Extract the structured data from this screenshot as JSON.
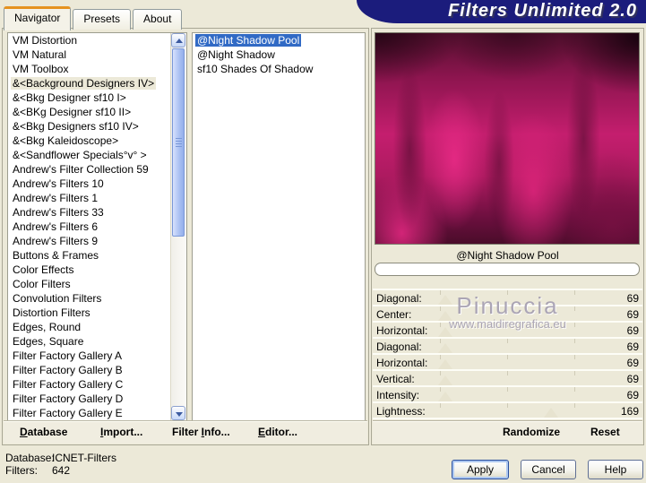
{
  "window": {
    "title": "Filters Unlimited 2.0"
  },
  "tabs": [
    {
      "label": "Navigator",
      "active": true
    },
    {
      "label": "Presets",
      "active": false
    },
    {
      "label": "About",
      "active": false
    }
  ],
  "category_list": {
    "selected_index": 3,
    "items": [
      "VM Distortion",
      "VM Natural",
      "VM Toolbox",
      "&<Background Designers IV>",
      "&<Bkg Designer sf10 I>",
      "&<BKg Designer sf10 II>",
      "&<Bkg Designers sf10 IV>",
      "&<Bkg Kaleidoscope>",
      "&<Sandflower Specials°v° >",
      "Andrew's Filter Collection 59",
      "Andrew's Filters 10",
      "Andrew's Filters 1",
      "Andrew's Filters 33",
      "Andrew's Filters 6",
      "Andrew's Filters 9",
      "Buttons & Frames",
      "Color Effects",
      "Color Filters",
      "Convolution Filters",
      "Distortion Filters",
      "Edges, Round",
      "Edges, Square",
      "Filter Factory Gallery A",
      "Filter Factory Gallery B",
      "Filter Factory Gallery C",
      "Filter Factory Gallery D",
      "Filter Factory Gallery E"
    ]
  },
  "filter_list": {
    "selected_index": 0,
    "items": [
      "@Night Shadow Pool",
      "@Night Shadow",
      "sf10 Shades Of Shadow"
    ]
  },
  "preview": {
    "filter_name": "@Night Shadow Pool",
    "progress_percent": 0
  },
  "sliders": [
    {
      "label": "Diagonal:",
      "value": 69
    },
    {
      "label": "Center:",
      "value": 69
    },
    {
      "label": "Horizontal:",
      "value": 69
    },
    {
      "label": "Diagonal:",
      "value": 69
    },
    {
      "label": "Horizontal:",
      "value": 69
    },
    {
      "label": "Vertical:",
      "value": 69
    },
    {
      "label": "Intensity:",
      "value": 69
    },
    {
      "label": "Lightness:",
      "value": 169
    }
  ],
  "toolbar_left": [
    {
      "pre": "",
      "key": "D",
      "post": "atabase"
    },
    {
      "pre": "",
      "key": "I",
      "post": "mport..."
    },
    {
      "pre": "Filter ",
      "key": "I",
      "post": "nfo..."
    },
    {
      "pre": "",
      "key": "E",
      "post": "ditor..."
    }
  ],
  "toolbar_right": {
    "randomize": "Randomize",
    "reset": "Reset"
  },
  "status": {
    "database_label": "Database:",
    "database_value": "ICNET-Filters",
    "filters_label": "Filters:",
    "filters_value": "642"
  },
  "actions": {
    "apply": "Apply",
    "cancel": "Cancel",
    "help": "Help"
  },
  "watermark": {
    "line1": "Pinuccia",
    "line2": "www.maidiregrafica.eu"
  },
  "colors": {
    "dialog_background": "#ece9d8",
    "banner_blue": "#1b1c7c",
    "selection_blue": "#316ac5",
    "inactive_selection": "#ece9d8",
    "tab_accent_orange": "#e5921f",
    "preview_magenta": "#c41e6e"
  }
}
